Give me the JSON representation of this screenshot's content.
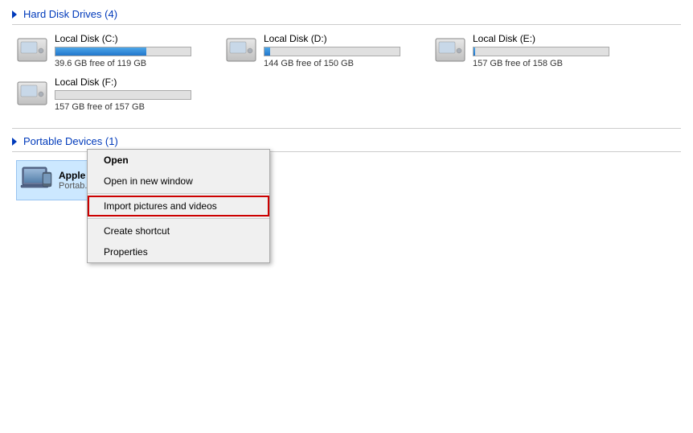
{
  "sections": {
    "hard_disk_drives": {
      "title": "Hard Disk Drives",
      "count": "(4)",
      "drives": [
        {
          "name": "Local Disk (C:)",
          "free": "39.6 GB free of 119 GB",
          "fill_percent": 67
        },
        {
          "name": "Local Disk (D:)",
          "free": "144 GB free of 150 GB",
          "fill_percent": 4
        },
        {
          "name": "Local Disk (E:)",
          "free": "157 GB free of 158 GB",
          "fill_percent": 1
        },
        {
          "name": "Local Disk (F:)",
          "free": "157 GB free of 157 GB",
          "fill_percent": 0
        }
      ]
    },
    "portable_devices": {
      "title": "Portable Devices",
      "count": "(1)",
      "devices": [
        {
          "name": "Apple iPhone",
          "sub": "Portab..."
        }
      ]
    }
  },
  "context_menu": {
    "items": [
      {
        "label": "Open",
        "bold": true,
        "highlighted": false,
        "separator_after": false
      },
      {
        "label": "Open in new window",
        "bold": false,
        "highlighted": false,
        "separator_after": true
      },
      {
        "label": "Import pictures and videos",
        "bold": false,
        "highlighted": true,
        "separator_after": true
      },
      {
        "label": "Create shortcut",
        "bold": false,
        "highlighted": false,
        "separator_after": false
      },
      {
        "label": "Properties",
        "bold": false,
        "highlighted": false,
        "separator_after": false
      }
    ]
  }
}
